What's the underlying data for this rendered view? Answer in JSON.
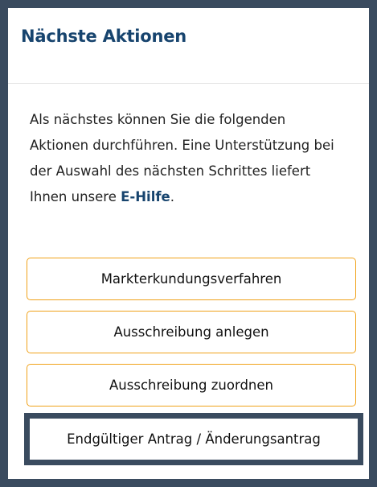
{
  "panel": {
    "title": "Nächste Aktionen",
    "intro_text": "Als nächstes können Sie die folgenden Aktionen durchführen. Eine Unterstützung bei der Auswahl des nächsten Schrittes liefert Ihnen unsere ",
    "help_link_label": "E-Hilfe",
    "intro_suffix": "."
  },
  "actions": {
    "market_exploration_label": "Markterkundungsverfahren",
    "create_tender_label": "Ausschreibung anlegen",
    "assign_tender_label": "Ausschreibung zuordnen",
    "final_application_label": "Endgültiger Antrag / Änderungsantrag"
  },
  "colors": {
    "frame": "#3a4b5f",
    "title": "#17446e",
    "button_border": "#f0a21a"
  }
}
